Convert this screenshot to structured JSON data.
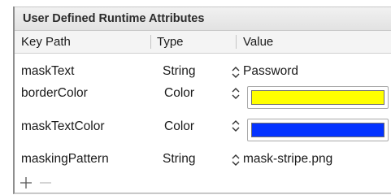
{
  "title": "User Defined Runtime Attributes",
  "columns": {
    "key_path": "Key Path",
    "type": "Type",
    "value": "Value"
  },
  "rows": [
    {
      "key": "maskText",
      "type": "String",
      "value": "Password"
    },
    {
      "key": "borderColor",
      "type": "Color",
      "value_color": "#ffff00"
    },
    {
      "key": "maskTextColor",
      "type": "Color",
      "value_color": "#0433ff"
    },
    {
      "key": "maskingPattern",
      "type": "String",
      "value": "mask-stripe.png"
    }
  ],
  "footer": {
    "add_icon": "plus-icon",
    "remove_icon": "minus-icon"
  }
}
